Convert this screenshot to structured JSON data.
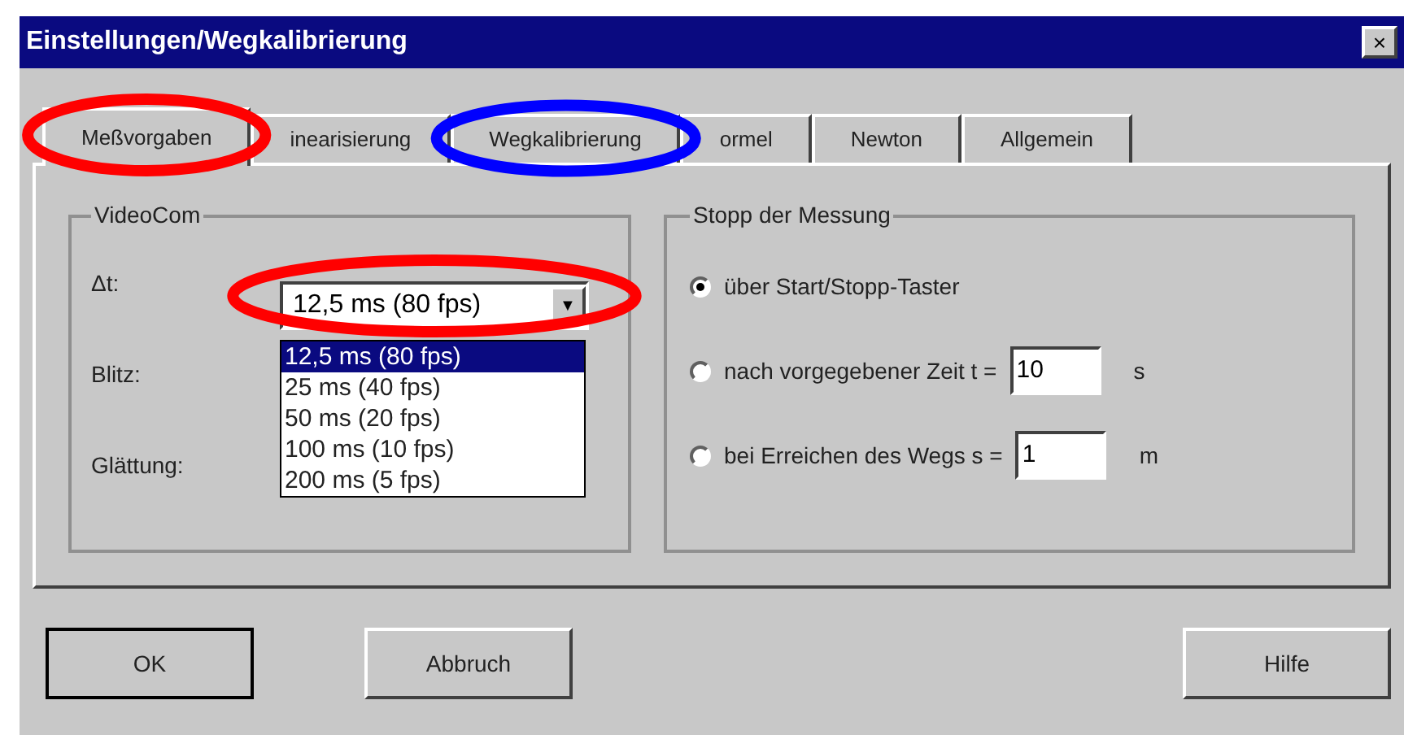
{
  "window": {
    "title": "Einstellungen/Wegkalibrierung",
    "close": "×"
  },
  "tabs": [
    {
      "label": "Meßvorgaben",
      "selected": true
    },
    {
      "label": "inearisierung",
      "selected": false
    },
    {
      "label": "Wegkalibrierung",
      "selected": false
    },
    {
      "label": "ormel",
      "selected": false
    },
    {
      "label": "Newton",
      "selected": false
    },
    {
      "label": "Allgemein",
      "selected": false
    }
  ],
  "videocom": {
    "title": "VideoCom",
    "labels": [
      "Δt:",
      "Blitz:",
      "Glättung:"
    ],
    "dt_value": "12,5 ms (80 fps)",
    "dropdown_arrow": "▼",
    "options": [
      {
        "label": "12,5 ms (80 fps)",
        "selected": true
      },
      {
        "label": "25 ms (40 fps)",
        "selected": false
      },
      {
        "label": "50 ms (20 fps)",
        "selected": false
      },
      {
        "label": "100 ms (10 fps)",
        "selected": false
      },
      {
        "label": "200 ms (5 fps)",
        "selected": false
      }
    ]
  },
  "stop": {
    "title": "Stopp der Messung",
    "options": [
      {
        "label": "über Start/Stopp-Taster",
        "selected": true
      },
      {
        "label": "nach vorgegebener Zeit t =",
        "selected": false,
        "value": "10",
        "unit": "s"
      },
      {
        "label": "bei Erreichen des Wegs s =",
        "selected": false,
        "value": "1",
        "unit": "m"
      }
    ]
  },
  "buttons": [
    {
      "label": "OK",
      "default": true
    },
    {
      "label": "Abbruch",
      "default": false
    },
    {
      "label": "Hilfe",
      "default": false
    }
  ],
  "annotations": [
    {
      "color": "#ff0000"
    },
    {
      "color": "#0000ff"
    },
    {
      "color": "#ff0000"
    }
  ]
}
